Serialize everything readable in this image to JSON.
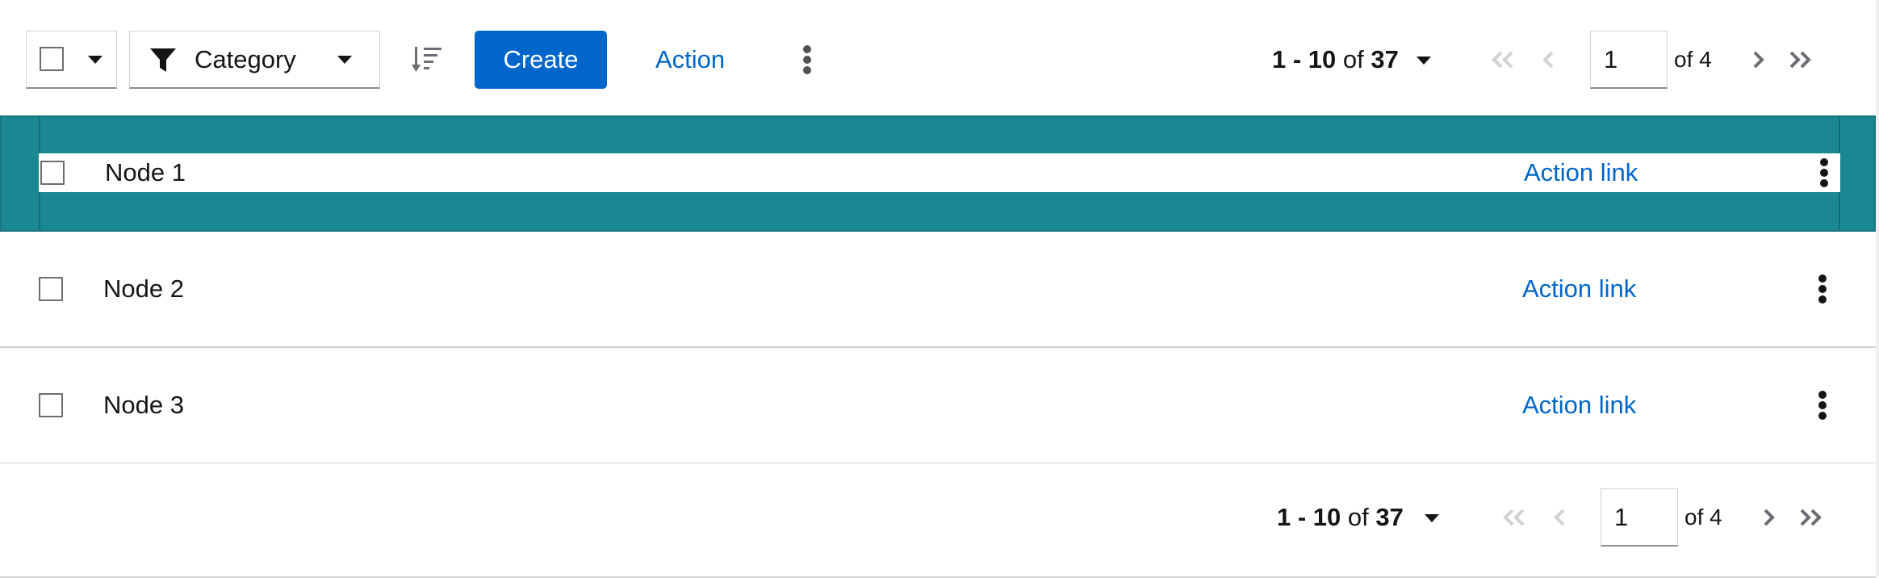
{
  "toolbar": {
    "bulk_select": {
      "checked": false,
      "icon": "caret-down-icon"
    },
    "filter": {
      "icon": "filter-icon",
      "label": "Category",
      "caret": "caret-down-icon"
    },
    "sort": {
      "icon": "sort-amount-down-icon"
    },
    "create_label": "Create",
    "action_label": "Action",
    "overflow_icon": "ellipsis-v-icon"
  },
  "pagination_top": {
    "range": "1 - 10",
    "of_word": "of",
    "total": "37",
    "page": "1",
    "of_pages": "of 4"
  },
  "rows": [
    {
      "name": "Node 1",
      "action_link": "Action link",
      "selected": true
    },
    {
      "name": "Node 2",
      "action_link": "Action link",
      "selected": false
    },
    {
      "name": "Node 3",
      "action_link": "Action link",
      "selected": false
    }
  ],
  "pagination_bottom": {
    "range": "1 - 10",
    "of_word": "of",
    "total": "37",
    "page": "1",
    "of_pages": "of 4"
  },
  "colors": {
    "primary": "#0066cc",
    "selected_row": "#1b8793",
    "text": "#151515",
    "border": "#d2d2d2",
    "disabled_icon": "#d2d2d2"
  }
}
